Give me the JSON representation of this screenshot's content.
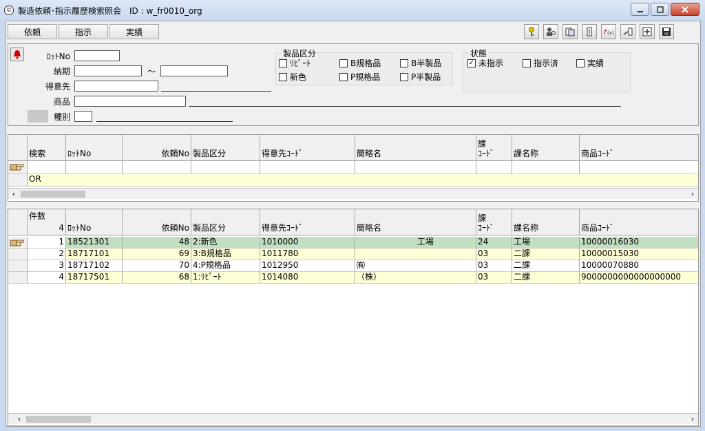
{
  "window": {
    "title": "製造依頼･指示履歴検索照会　ID : w_fr0010_org",
    "icon": "app-icon"
  },
  "tabs": [
    "依頼",
    "指示",
    "実績"
  ],
  "toolbar_icons": [
    "key-icon",
    "user-search-icon",
    "copy-icon",
    "column-icon",
    "function-icon",
    "export-icon",
    "expand-icon",
    "save-icon"
  ],
  "search": {
    "lot_no_label": "ﾛｯﾄNo",
    "due_label": "納期",
    "range_sep": "～",
    "customer_label": "得意先",
    "product_label": "商品",
    "type_label": "種別",
    "product_category_title": "製品区分",
    "categories": [
      {
        "label": "ﾘﾋﾟｰﾄ",
        "checked": false
      },
      {
        "label": "B規格品",
        "checked": false
      },
      {
        "label": "B半製品",
        "checked": false
      },
      {
        "label": "新色",
        "checked": false
      },
      {
        "label": "P規格品",
        "checked": false
      },
      {
        "label": "P半製品",
        "checked": false
      }
    ],
    "status_title": "状態",
    "statuses": [
      {
        "label": "未指示",
        "checked": true
      },
      {
        "label": "指示済",
        "checked": false
      },
      {
        "label": "実績",
        "checked": false
      }
    ]
  },
  "criteria_grid": {
    "headers": [
      "検索",
      "ﾛｯﾄNo",
      "依頼No",
      "製品区分",
      "得意先ｺｰﾄﾞ",
      "簡略名",
      "課\nｺｰﾄﾞ",
      "課名称",
      "商品ｺｰﾄﾞ"
    ],
    "row2_label": "OR"
  },
  "results_grid": {
    "count_label": "件数",
    "count": "4",
    "headers": [
      "ﾛｯﾄNo",
      "依頼No",
      "製品区分",
      "得意先ｺｰﾄﾞ",
      "簡略名",
      "課\nｺｰﾄﾞ",
      "課名称",
      "商品ｺｰﾄﾞ"
    ],
    "rows": [
      {
        "no": "1",
        "lot": "18521301",
        "req": "48",
        "cat": "2:新色",
        "cust": "1010000",
        "name": "　　　　　　　 工場",
        "sect": "24",
        "sect_name": "工場",
        "prod": "10000016030",
        "bg": "#c3dfc2"
      },
      {
        "no": "2",
        "lot": "18717101",
        "req": "69",
        "cat": "3:B規格品",
        "cust": "1011780",
        "name": "",
        "sect": "03",
        "sect_name": "二課",
        "prod": "10000015030",
        "bg": "#ffffd6"
      },
      {
        "no": "3",
        "lot": "18717102",
        "req": "70",
        "cat": "4:P規格品",
        "cust": "1012950",
        "name": "㈲",
        "sect": "03",
        "sect_name": "二課",
        "prod": "10000070880",
        "bg": "#ffffff"
      },
      {
        "no": "4",
        "lot": "18717501",
        "req": "68",
        "cat": "1:ﾘﾋﾟｰﾄ",
        "cust": "1014080",
        "name": "（株）",
        "sect": "03",
        "sect_name": "二課",
        "prod": "9000000000000000000",
        "bg": "#ffffd6"
      }
    ]
  },
  "colors": {
    "selected_row": "#c3dfc2",
    "alt_row": "#ffffd6"
  }
}
